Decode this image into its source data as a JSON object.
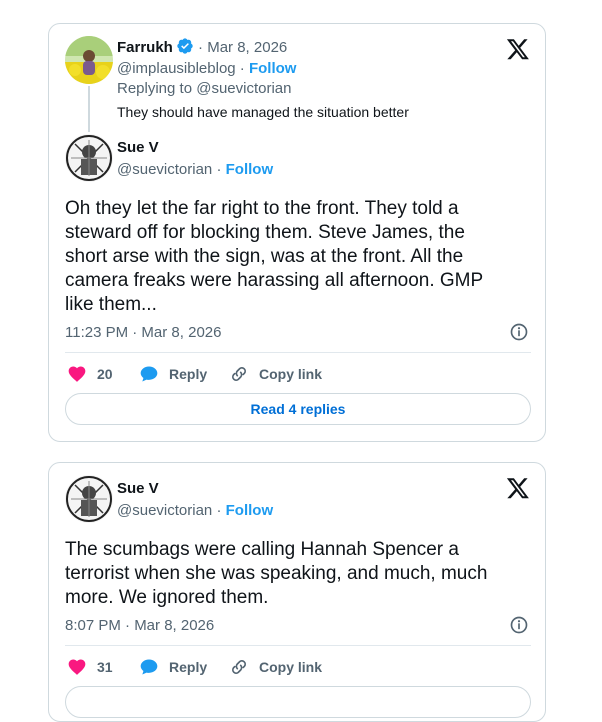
{
  "tweets": [
    {
      "parent": {
        "author_name": "Farrukh",
        "separator": "·",
        "date": "Mar 8, 2026",
        "handle": "@implausibleblog",
        "dot": "·",
        "follow_label": "Follow",
        "replying_to": "Replying to @suevictorian",
        "text": "They should have managed the situation better"
      },
      "reply": {
        "author_name": "Sue V",
        "handle": "@suevictorian",
        "dot": "·",
        "follow_label": "Follow",
        "text": "Oh they let the far right to the front. They told a steward off for blocking them. Steve James, the short arse with the sign, was at the front. All the camera freaks were harassing all afternoon. GMP like them...",
        "timestamp": "11:23 PM · Mar 8, 2026",
        "likes": "20",
        "reply_label": "Reply",
        "copy_link_label": "Copy link",
        "read_replies_label": "Read 4 replies"
      }
    },
    {
      "reply": {
        "author_name": "Sue V",
        "handle": "@suevictorian",
        "dot": "·",
        "follow_label": "Follow",
        "text": "The scumbags were calling Hannah Spencer a terrorist when she was speaking, and much, much more. We ignored them.",
        "timestamp": "8:07 PM · Mar 8, 2026",
        "likes": "31",
        "reply_label": "Reply",
        "copy_link_label": "Copy link"
      }
    }
  ],
  "colors": {
    "like": "#f91880",
    "reply_bubble": "#1d9bf0",
    "follow": "#1d9bf0",
    "verified": "#1d9bf0"
  },
  "icons": [
    "x-logo-icon",
    "verified-badge-icon",
    "heart-icon",
    "reply-bubble-icon",
    "link-icon",
    "info-icon"
  ]
}
